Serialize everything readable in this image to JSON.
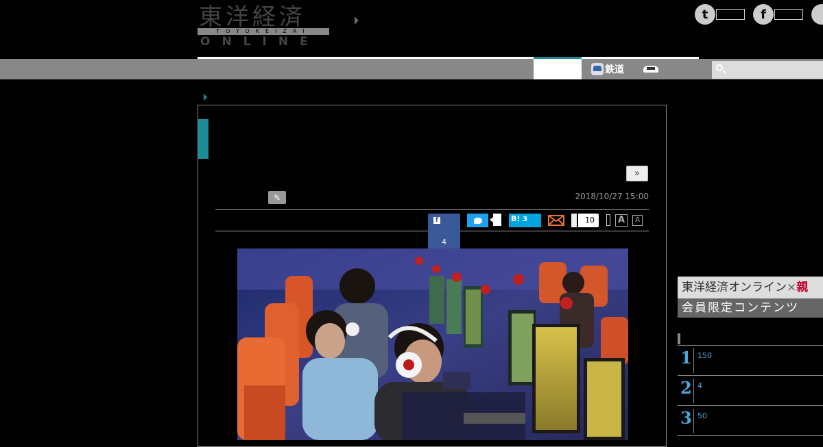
{
  "header": {
    "logo_kanji": "東洋経済",
    "logo_sub": "TOYOKEIZAI",
    "logo_online": "ONLINE",
    "social": [
      {
        "name": "twitter",
        "glyph": "t"
      },
      {
        "name": "facebook",
        "glyph": "f"
      }
    ]
  },
  "nav": {
    "rail_label": "鉄道"
  },
  "search": {
    "placeholder": ""
  },
  "article": {
    "next_label": "»",
    "date": "2018/10/27 15:00",
    "share": {
      "facebook_glyph": "f",
      "facebook_count": "4",
      "hatena_label": "B!",
      "hatena_count": "3",
      "pocket_count": "10"
    },
    "font_size_large": "A",
    "font_size_small": "A"
  },
  "sidebar": {
    "banner_title": "東洋経済オンライン",
    "banner_times": "×",
    "banner_brand": "親",
    "banner_sub": "会員限定コンテンツ",
    "ranking": [
      {
        "rank": "1",
        "value": "150"
      },
      {
        "rank": "2",
        "value": "4"
      },
      {
        "rank": "3",
        "value": "50"
      }
    ]
  },
  "colors": {
    "accent": "#1b8c99",
    "facebook": "#3b5998",
    "twitter": "#1da1f2",
    "hatena": "#00a4de",
    "ranking": "#4da6d9"
  }
}
